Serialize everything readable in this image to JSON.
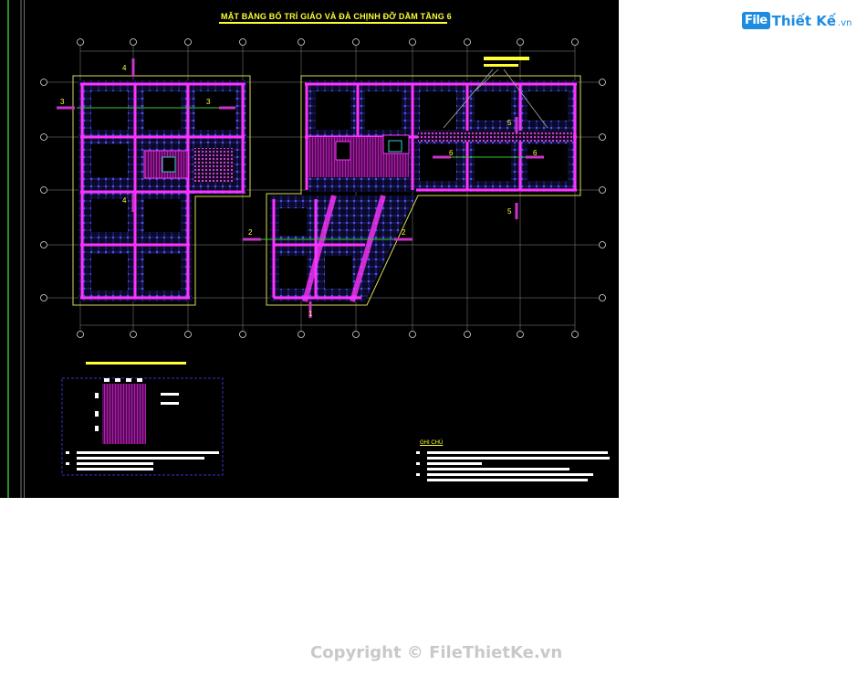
{
  "drawing": {
    "title": "MẶT BẰNG BỐ TRÍ GIÁO VÀ ĐÀ CHỊNH ĐỠ DẦM TẦNG 6",
    "notes_title": "GHI CHÚ",
    "section_marks": [
      "1",
      "2",
      "2",
      "3",
      "3",
      "4",
      "4",
      "5",
      "5",
      "6",
      "6"
    ]
  },
  "logo": {
    "badge": "File",
    "name": "Thiết Kế",
    "suffix": ".vn"
  },
  "watermark": {
    "copyright": "Copyright © FileThietKe.vn"
  },
  "colors": {
    "background": "#000000",
    "title": "#ffff33",
    "beam": "#ff33ff",
    "scaffold": "#4d4dff",
    "wall": "#d8d860",
    "grid": "#bbbbbb",
    "section": "#cc33cc"
  }
}
